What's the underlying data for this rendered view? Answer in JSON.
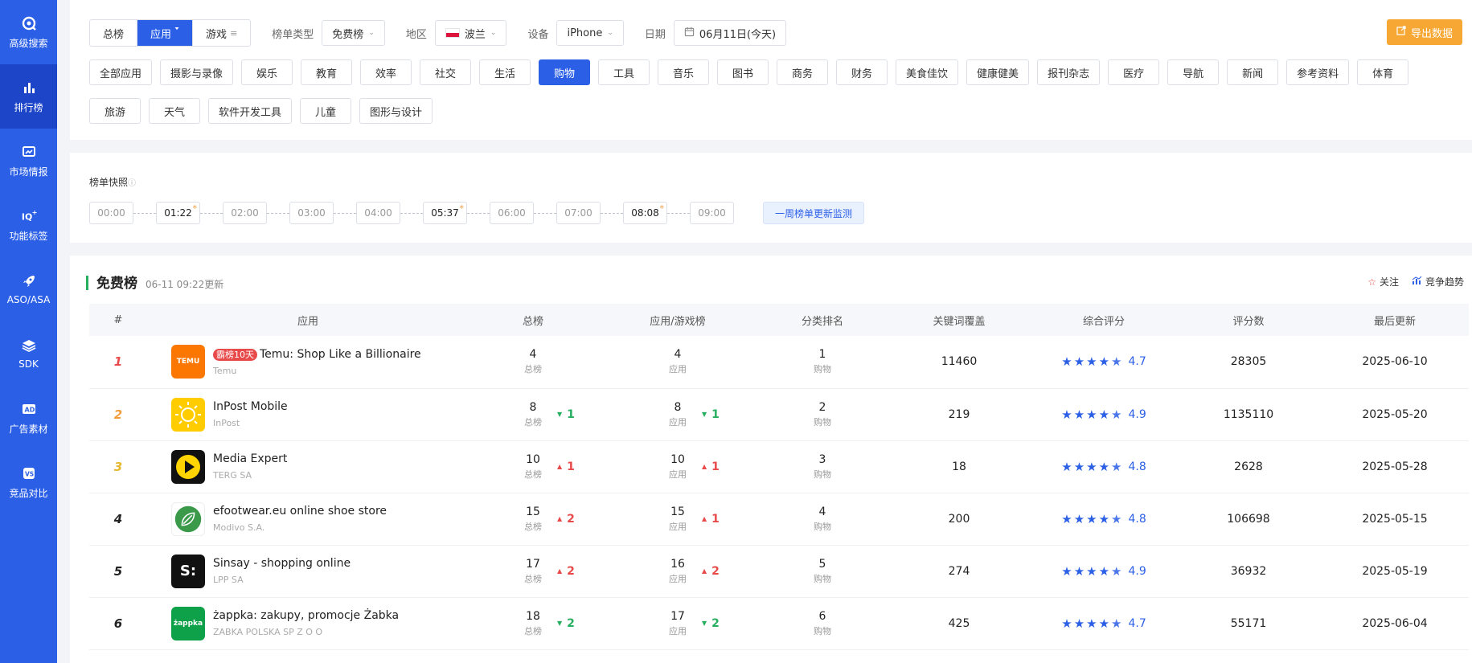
{
  "sidebar": [
    {
      "label": "高级搜索",
      "icon": "search-icon",
      "active": false
    },
    {
      "label": "排行榜",
      "icon": "ranking-icon",
      "active": true
    },
    {
      "label": "市场情报",
      "icon": "market-icon",
      "active": false
    },
    {
      "label": "功能标签",
      "icon": "tag-icon",
      "active": false
    },
    {
      "label": "ASO/ASA",
      "icon": "rocket-icon",
      "active": false
    },
    {
      "label": "SDK",
      "icon": "layers-icon",
      "active": false
    },
    {
      "label": "广告素材",
      "icon": "ad-icon",
      "active": false
    },
    {
      "label": "竞品对比",
      "icon": "vs-icon",
      "active": false
    }
  ],
  "filters": {
    "tab_all": "总榜",
    "tab_app": "应用",
    "tab_game": "游戏",
    "list_type_label": "榜单类型",
    "list_type_value": "免费榜",
    "region_label": "地区",
    "region_value": "波兰",
    "device_label": "设备",
    "device_value": "iPhone",
    "date_label": "日期",
    "date_value": "06月11日(今天)",
    "export_label": "导出数据"
  },
  "categories": [
    {
      "label": "全部应用",
      "active": false
    },
    {
      "label": "摄影与录像",
      "active": false
    },
    {
      "label": "娱乐",
      "active": false
    },
    {
      "label": "教育",
      "active": false
    },
    {
      "label": "效率",
      "active": false
    },
    {
      "label": "社交",
      "active": false
    },
    {
      "label": "生活",
      "active": false
    },
    {
      "label": "购物",
      "active": true
    },
    {
      "label": "工具",
      "active": false
    },
    {
      "label": "音乐",
      "active": false
    },
    {
      "label": "图书",
      "active": false
    },
    {
      "label": "商务",
      "active": false
    },
    {
      "label": "财务",
      "active": false
    },
    {
      "label": "美食佳饮",
      "active": false
    },
    {
      "label": "健康健美",
      "active": false
    },
    {
      "label": "报刊杂志",
      "active": false
    },
    {
      "label": "医疗",
      "active": false
    },
    {
      "label": "导航",
      "active": false
    },
    {
      "label": "新闻",
      "active": false
    },
    {
      "label": "参考资料",
      "active": false
    },
    {
      "label": "体育",
      "active": false
    },
    {
      "label": "旅游",
      "active": false
    },
    {
      "label": "天气",
      "active": false
    },
    {
      "label": "软件开发工具",
      "active": false
    },
    {
      "label": "儿童",
      "active": false
    },
    {
      "label": "图形与设计",
      "active": false
    }
  ],
  "snapshot": {
    "title": "榜单快照",
    "times": [
      {
        "t": "00:00",
        "marked": false
      },
      {
        "t": "01:22",
        "marked": true
      },
      {
        "t": "02:00",
        "marked": false
      },
      {
        "t": "03:00",
        "marked": false
      },
      {
        "t": "04:00",
        "marked": false
      },
      {
        "t": "05:37",
        "marked": true
      },
      {
        "t": "06:00",
        "marked": false
      },
      {
        "t": "07:00",
        "marked": false
      },
      {
        "t": "08:08",
        "marked": true
      },
      {
        "t": "09:00",
        "marked": false
      }
    ],
    "week_monitor": "一周榜单更新监测"
  },
  "list": {
    "title": "免费榜",
    "updated": "06-11 09:22更新",
    "follow": "关注",
    "trend": "竞争趋势",
    "columns": [
      "#",
      "应用",
      "总榜",
      "应用/游戏榜",
      "分类排名",
      "关键词覆盖",
      "综合评分",
      "评分数",
      "最后更新"
    ],
    "rows": [
      {
        "rank": "1",
        "badge": "霸榜10天",
        "name": "Temu: Shop Like a Billionaire",
        "dev": "Temu",
        "icon_text": "TEMU",
        "icon_bg": "#fb7701",
        "icon_fg": "#ffffff",
        "total": "4",
        "total_sub": "总榜",
        "total_delta": "",
        "total_dir": "",
        "app": "4",
        "app_sub": "应用",
        "app_delta": "",
        "app_dir": "",
        "cat": "1",
        "cat_sub": "购物",
        "keywords": "11460",
        "score": "4.7",
        "score_value": 4.7,
        "ratings": "28305",
        "updated": "2025-06-10"
      },
      {
        "rank": "2",
        "badge": "",
        "name": "InPost Mobile",
        "dev": "InPost",
        "icon_text": "",
        "icon_bg": "#ffcc00",
        "icon_fg": "#ffffff",
        "total": "8",
        "total_sub": "总榜",
        "total_delta": "1",
        "total_dir": "down",
        "app": "8",
        "app_sub": "应用",
        "app_delta": "1",
        "app_dir": "down",
        "cat": "2",
        "cat_sub": "购物",
        "keywords": "219",
        "score": "4.9",
        "score_value": 4.9,
        "ratings": "1135110",
        "updated": "2025-05-20"
      },
      {
        "rank": "3",
        "badge": "",
        "name": "Media Expert",
        "dev": "TERG SA",
        "icon_text": "",
        "icon_bg": "#111111",
        "icon_fg": "#ffd400",
        "total": "10",
        "total_sub": "总榜",
        "total_delta": "1",
        "total_dir": "up",
        "app": "10",
        "app_sub": "应用",
        "app_delta": "1",
        "app_dir": "up",
        "cat": "3",
        "cat_sub": "购物",
        "keywords": "18",
        "score": "4.8",
        "score_value": 4.8,
        "ratings": "2628",
        "updated": "2025-05-28"
      },
      {
        "rank": "4",
        "badge": "",
        "name": "efootwear.eu online shoe store",
        "dev": "Modivo S.A.",
        "icon_text": "",
        "icon_bg": "#ffffff",
        "icon_fg": "#3a9a4a",
        "total": "15",
        "total_sub": "总榜",
        "total_delta": "2",
        "total_dir": "up",
        "app": "15",
        "app_sub": "应用",
        "app_delta": "1",
        "app_dir": "up",
        "cat": "4",
        "cat_sub": "购物",
        "keywords": "200",
        "score": "4.8",
        "score_value": 4.8,
        "ratings": "106698",
        "updated": "2025-05-15"
      },
      {
        "rank": "5",
        "badge": "",
        "name": "Sinsay - shopping online",
        "dev": "LPP SA",
        "icon_text": "S:",
        "icon_bg": "#111111",
        "icon_fg": "#ffffff",
        "total": "17",
        "total_sub": "总榜",
        "total_delta": "2",
        "total_dir": "up",
        "app": "16",
        "app_sub": "应用",
        "app_delta": "2",
        "app_dir": "up",
        "cat": "5",
        "cat_sub": "购物",
        "keywords": "274",
        "score": "4.9",
        "score_value": 4.9,
        "ratings": "36932",
        "updated": "2025-05-19"
      },
      {
        "rank": "6",
        "badge": "",
        "name": "żappka: zakupy, promocje Żabka",
        "dev": "ZABKA POLSKA SP Z O O",
        "icon_text": "żappka",
        "icon_bg": "#0fa14a",
        "icon_fg": "#ffffff",
        "total": "18",
        "total_sub": "总榜",
        "total_delta": "2",
        "total_dir": "down",
        "app": "17",
        "app_sub": "应用",
        "app_delta": "2",
        "app_dir": "down",
        "cat": "6",
        "cat_sub": "购物",
        "keywords": "425",
        "score": "4.7",
        "score_value": 4.7,
        "ratings": "55171",
        "updated": "2025-06-04"
      }
    ]
  }
}
